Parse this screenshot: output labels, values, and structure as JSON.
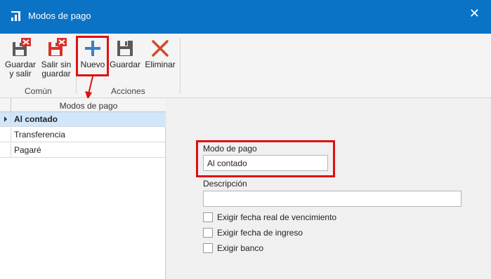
{
  "window": {
    "title": "Modos de pago",
    "close_icon": "close-icon"
  },
  "ribbon": {
    "save_exit_label_1": "Guardar",
    "save_exit_label_2": "y salir",
    "exit_nosave_label_1": "Salir sin",
    "exit_nosave_label_2": "guardar",
    "new_label": "Nuevo",
    "save_label": "Guardar",
    "delete_label": "Eliminar",
    "group_comun": "Común",
    "group_acciones": "Acciones"
  },
  "grid": {
    "column_header": "Modos de pago",
    "rows": [
      "Al contado",
      "Transferencia",
      "Pagaré"
    ],
    "selected_index": 0
  },
  "form": {
    "mode_label": "Modo de pago",
    "mode_value": "Al contado",
    "desc_label": "Descripción",
    "desc_value": "",
    "check1": "Exigir fecha real de vencimiento",
    "check2": "Exigir fecha de ingreso",
    "check3": "Exigir banco"
  },
  "colors": {
    "titlebar": "#0a73c6",
    "highlight": "#e01010",
    "selected_row": "#cfe6fb"
  }
}
